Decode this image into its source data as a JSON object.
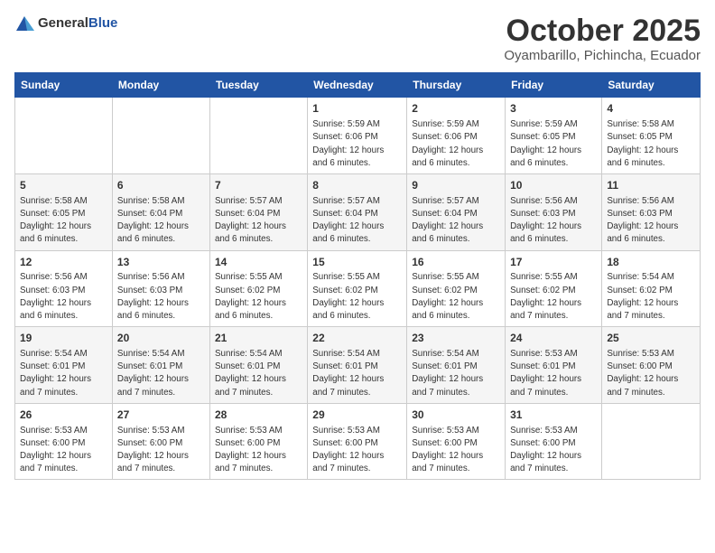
{
  "logo": {
    "general": "General",
    "blue": "Blue"
  },
  "title": "October 2025",
  "subtitle": "Oyambarillo, Pichincha, Ecuador",
  "days_of_week": [
    "Sunday",
    "Monday",
    "Tuesday",
    "Wednesday",
    "Thursday",
    "Friday",
    "Saturday"
  ],
  "weeks": [
    [
      {
        "num": "",
        "info": ""
      },
      {
        "num": "",
        "info": ""
      },
      {
        "num": "",
        "info": ""
      },
      {
        "num": "1",
        "info": "Sunrise: 5:59 AM\nSunset: 6:06 PM\nDaylight: 12 hours\nand 6 minutes."
      },
      {
        "num": "2",
        "info": "Sunrise: 5:59 AM\nSunset: 6:06 PM\nDaylight: 12 hours\nand 6 minutes."
      },
      {
        "num": "3",
        "info": "Sunrise: 5:59 AM\nSunset: 6:05 PM\nDaylight: 12 hours\nand 6 minutes."
      },
      {
        "num": "4",
        "info": "Sunrise: 5:58 AM\nSunset: 6:05 PM\nDaylight: 12 hours\nand 6 minutes."
      }
    ],
    [
      {
        "num": "5",
        "info": "Sunrise: 5:58 AM\nSunset: 6:05 PM\nDaylight: 12 hours\nand 6 minutes."
      },
      {
        "num": "6",
        "info": "Sunrise: 5:58 AM\nSunset: 6:04 PM\nDaylight: 12 hours\nand 6 minutes."
      },
      {
        "num": "7",
        "info": "Sunrise: 5:57 AM\nSunset: 6:04 PM\nDaylight: 12 hours\nand 6 minutes."
      },
      {
        "num": "8",
        "info": "Sunrise: 5:57 AM\nSunset: 6:04 PM\nDaylight: 12 hours\nand 6 minutes."
      },
      {
        "num": "9",
        "info": "Sunrise: 5:57 AM\nSunset: 6:04 PM\nDaylight: 12 hours\nand 6 minutes."
      },
      {
        "num": "10",
        "info": "Sunrise: 5:56 AM\nSunset: 6:03 PM\nDaylight: 12 hours\nand 6 minutes."
      },
      {
        "num": "11",
        "info": "Sunrise: 5:56 AM\nSunset: 6:03 PM\nDaylight: 12 hours\nand 6 minutes."
      }
    ],
    [
      {
        "num": "12",
        "info": "Sunrise: 5:56 AM\nSunset: 6:03 PM\nDaylight: 12 hours\nand 6 minutes."
      },
      {
        "num": "13",
        "info": "Sunrise: 5:56 AM\nSunset: 6:03 PM\nDaylight: 12 hours\nand 6 minutes."
      },
      {
        "num": "14",
        "info": "Sunrise: 5:55 AM\nSunset: 6:02 PM\nDaylight: 12 hours\nand 6 minutes."
      },
      {
        "num": "15",
        "info": "Sunrise: 5:55 AM\nSunset: 6:02 PM\nDaylight: 12 hours\nand 6 minutes."
      },
      {
        "num": "16",
        "info": "Sunrise: 5:55 AM\nSunset: 6:02 PM\nDaylight: 12 hours\nand 6 minutes."
      },
      {
        "num": "17",
        "info": "Sunrise: 5:55 AM\nSunset: 6:02 PM\nDaylight: 12 hours\nand 7 minutes."
      },
      {
        "num": "18",
        "info": "Sunrise: 5:54 AM\nSunset: 6:02 PM\nDaylight: 12 hours\nand 7 minutes."
      }
    ],
    [
      {
        "num": "19",
        "info": "Sunrise: 5:54 AM\nSunset: 6:01 PM\nDaylight: 12 hours\nand 7 minutes."
      },
      {
        "num": "20",
        "info": "Sunrise: 5:54 AM\nSunset: 6:01 PM\nDaylight: 12 hours\nand 7 minutes."
      },
      {
        "num": "21",
        "info": "Sunrise: 5:54 AM\nSunset: 6:01 PM\nDaylight: 12 hours\nand 7 minutes."
      },
      {
        "num": "22",
        "info": "Sunrise: 5:54 AM\nSunset: 6:01 PM\nDaylight: 12 hours\nand 7 minutes."
      },
      {
        "num": "23",
        "info": "Sunrise: 5:54 AM\nSunset: 6:01 PM\nDaylight: 12 hours\nand 7 minutes."
      },
      {
        "num": "24",
        "info": "Sunrise: 5:53 AM\nSunset: 6:01 PM\nDaylight: 12 hours\nand 7 minutes."
      },
      {
        "num": "25",
        "info": "Sunrise: 5:53 AM\nSunset: 6:00 PM\nDaylight: 12 hours\nand 7 minutes."
      }
    ],
    [
      {
        "num": "26",
        "info": "Sunrise: 5:53 AM\nSunset: 6:00 PM\nDaylight: 12 hours\nand 7 minutes."
      },
      {
        "num": "27",
        "info": "Sunrise: 5:53 AM\nSunset: 6:00 PM\nDaylight: 12 hours\nand 7 minutes."
      },
      {
        "num": "28",
        "info": "Sunrise: 5:53 AM\nSunset: 6:00 PM\nDaylight: 12 hours\nand 7 minutes."
      },
      {
        "num": "29",
        "info": "Sunrise: 5:53 AM\nSunset: 6:00 PM\nDaylight: 12 hours\nand 7 minutes."
      },
      {
        "num": "30",
        "info": "Sunrise: 5:53 AM\nSunset: 6:00 PM\nDaylight: 12 hours\nand 7 minutes."
      },
      {
        "num": "31",
        "info": "Sunrise: 5:53 AM\nSunset: 6:00 PM\nDaylight: 12 hours\nand 7 minutes."
      },
      {
        "num": "",
        "info": ""
      }
    ]
  ]
}
